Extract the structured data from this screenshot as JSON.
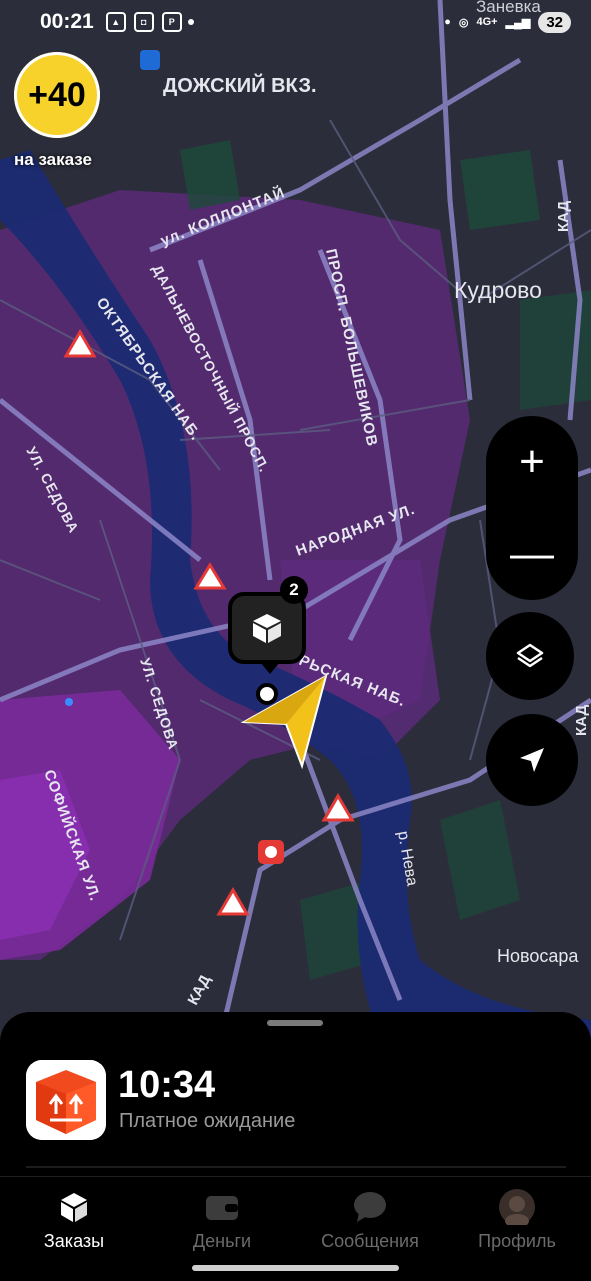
{
  "status_bar": {
    "time": "00:21",
    "battery": "32",
    "network": "4G+"
  },
  "bonus": {
    "value": "+40",
    "caption": "на заказе"
  },
  "map": {
    "labels": {
      "station": "ДОЖСКИЙ ВКЗ.",
      "zanevka": "Заневка",
      "kudrovo": "Кудрово",
      "kad_top": "КАД",
      "kad_right": "КАД",
      "kad_bottom": "КАД",
      "kollontai": "ул. КОЛЛОНТАЙ",
      "dalnevost": "ДАЛЬНЕВОСТОЧНЫЙ ПРОСП.",
      "bolshevikov": "ПРОСП. БОЛЬШЕВИКОВ",
      "oktyabrskaya": "ОКТЯБРЬСКАЯ НАБ.",
      "oktyabrskaya2": "РЬСКАЯ НАБ.",
      "narodnaya": "НАРОДНАЯ УЛ.",
      "sedova1": "УЛ. СЕДОВА",
      "sedova2": "УЛ. СЕДОВА",
      "sofiyskaya": "СОФИЙСКАЯ УЛ.",
      "neva": "р. Нева",
      "novosaratovka": "Новосара"
    },
    "order_pin_badge": "2"
  },
  "controls": {
    "zoom_in": "+",
    "zoom_out": "—"
  },
  "order": {
    "time": "10:34",
    "status": "Платное ожидание"
  },
  "tabs": [
    {
      "label": "Заказы",
      "icon": "box-icon",
      "active": true
    },
    {
      "label": "Деньги",
      "icon": "wallet-icon",
      "active": false
    },
    {
      "label": "Сообщения",
      "icon": "chat-icon",
      "active": false
    },
    {
      "label": "Профиль",
      "icon": "avatar-icon",
      "active": false
    }
  ],
  "colors": {
    "accent": "#f7d22a",
    "map_bg": "#2a2c3a",
    "heat": "#6a2c8a",
    "river": "#1a2a6e"
  }
}
